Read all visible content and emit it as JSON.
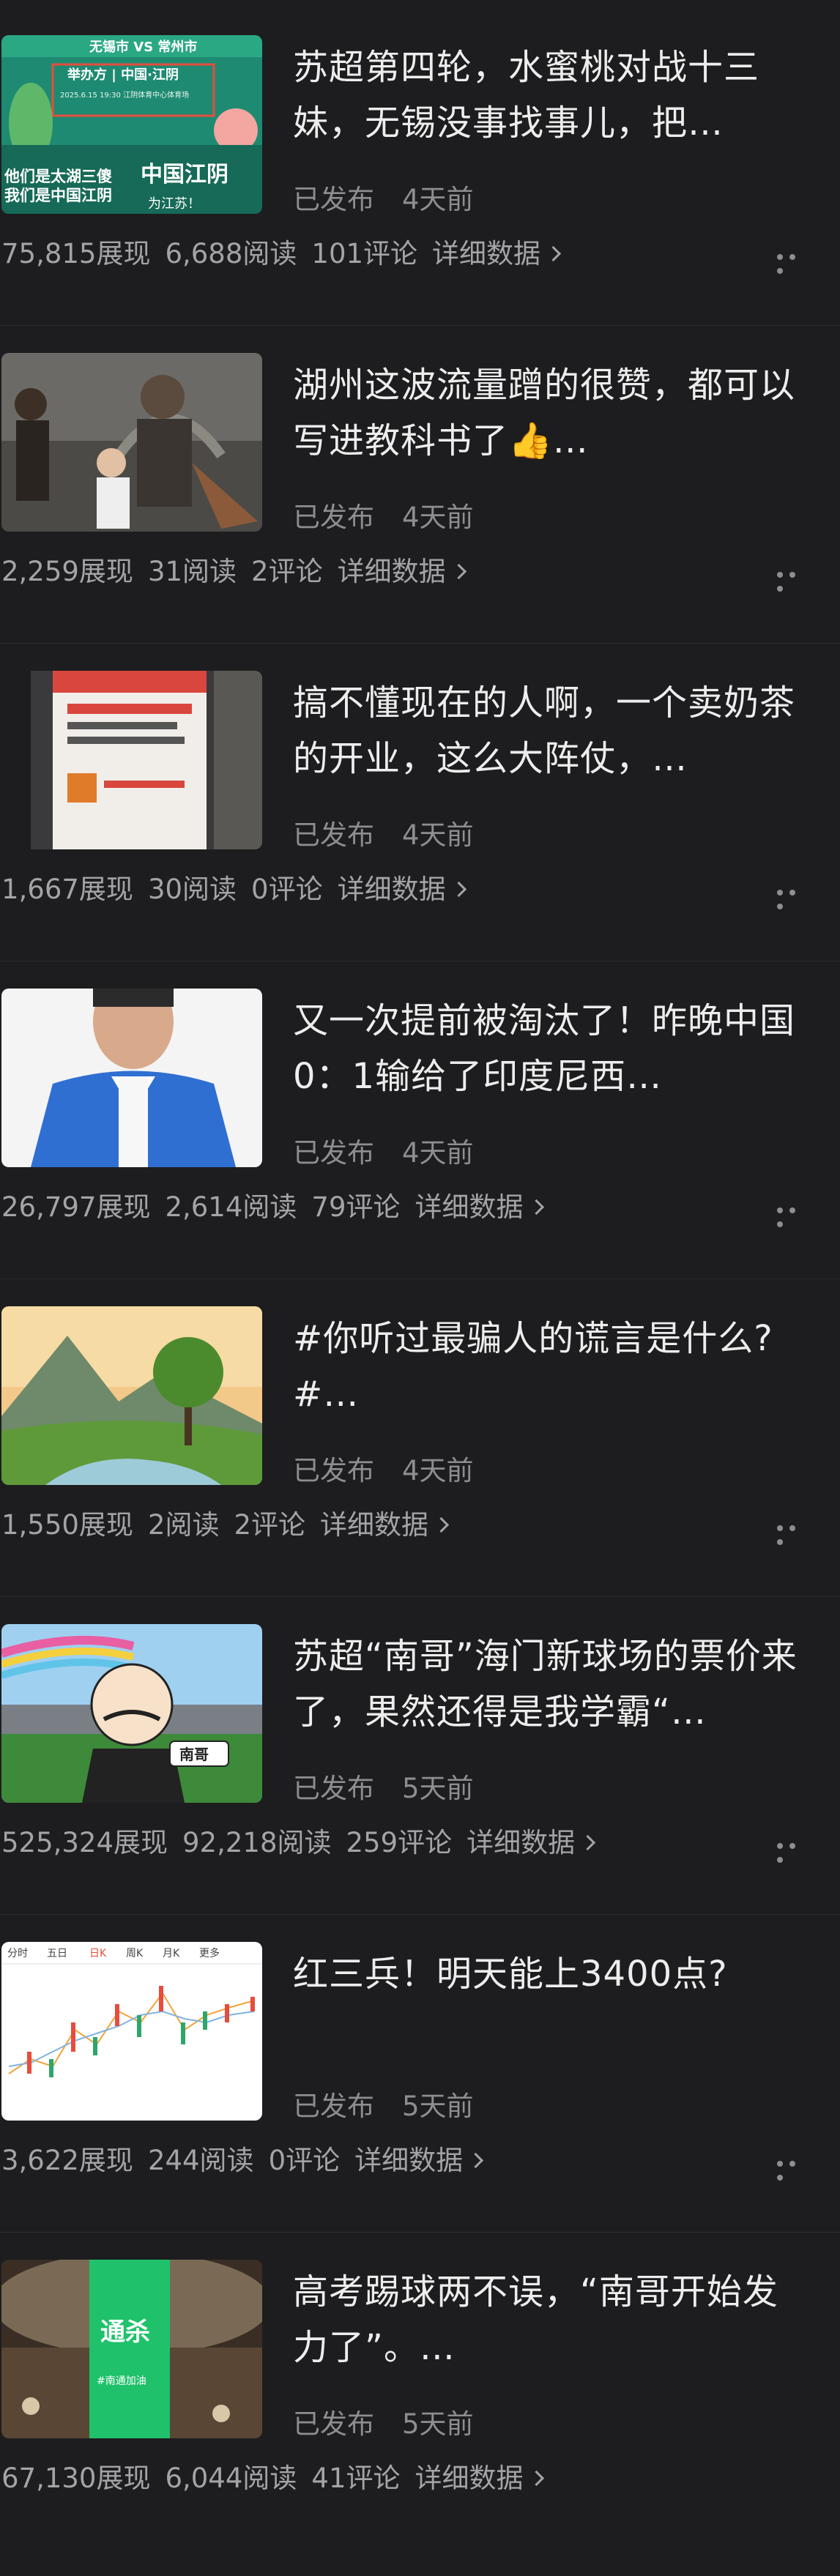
{
  "colors": {
    "background": "#1d1d1f",
    "text": "#ededed",
    "muted": "#8d8d92",
    "stats": "#a3a3a8"
  },
  "icons": {
    "more": "ellipsis-icon",
    "chevron": "chevron-right-icon"
  },
  "items": [
    {
      "title": "苏超第四轮，水蜜桃对战十三妹，无锡没事找事儿，把…",
      "status": "已发布",
      "time": "4天前",
      "views": "75,815展现",
      "reads": "6,688阅读",
      "comments": "101评论",
      "detail": "详细数据",
      "thumb_text": [
        "无锡市 VS 常州市",
        "举办方 | 中国·江阴",
        "2025.6.15 19:30 江阴体育中心体育场",
        "他们是太湖三傻",
        "我们是中国江阴",
        "中国江阴",
        "为江苏！"
      ]
    },
    {
      "title": "湖州这波流量蹭的很赞，都可以写进教科书了👍…",
      "status": "已发布",
      "time": "4天前",
      "views": "2,259展现",
      "reads": "31阅读",
      "comments": "2评论",
      "detail": "详细数据"
    },
    {
      "title": "搞不懂现在的人啊，一个卖奶茶的开业，这么大阵仗，…",
      "status": "已发布",
      "time": "4天前",
      "views": "1,667展现",
      "reads": "30阅读",
      "comments": "0评论",
      "detail": "详细数据"
    },
    {
      "title": "又一次提前被淘汰了！昨晚中国0：1输给了印度尼西…",
      "status": "已发布",
      "time": "4天前",
      "views": "26,797展现",
      "reads": "2,614阅读",
      "comments": "79评论",
      "detail": "详细数据"
    },
    {
      "title": "#你听过最骗人的谎言是什么?#…",
      "status": "已发布",
      "time": "4天前",
      "views": "1,550展现",
      "reads": "2阅读",
      "comments": "2评论",
      "detail": "详细数据"
    },
    {
      "title": "苏超“南哥”海门新球场的票价来了，果然还得是我学霸“…",
      "status": "已发布",
      "time": "5天前",
      "views": "525,324展现",
      "reads": "92,218阅读",
      "comments": "259评论",
      "detail": "详细数据",
      "thumb_text": [
        "南哥"
      ]
    },
    {
      "title": "红三兵！明天能上3400点?",
      "status": "已发布",
      "time": "5天前",
      "views": "3,622展现",
      "reads": "244阅读",
      "comments": "0评论",
      "detail": "详细数据",
      "thumb_text": [
        "分时",
        "五日",
        "日K",
        "周K",
        "月K",
        "更多"
      ]
    },
    {
      "title": "高考踢球两不误，“南哥开始发力了”。…",
      "status": "已发布",
      "time": "5天前",
      "views": "67,130展现",
      "reads": "6,044阅读",
      "comments": "41评论",
      "detail": "详细数据",
      "thumb_text": [
        "通杀",
        "#南通加油"
      ]
    }
  ]
}
